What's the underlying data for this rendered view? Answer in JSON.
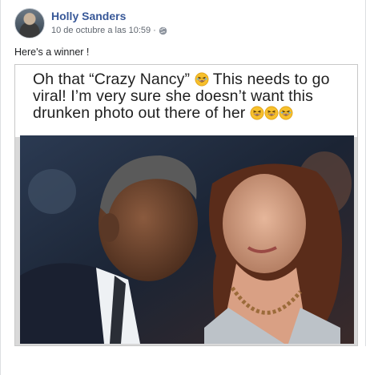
{
  "post": {
    "author": "Holly Sanders",
    "timestamp": "10 de octubre a las 10:59",
    "separator": "·",
    "privacy_icon": "globe-icon",
    "text": "Here's a winner !"
  },
  "media": {
    "caption_part1": "Oh that “Crazy Nancy”",
    "caption_part2": " This needs to go viral! I’m very sure she doesn’t want this drunken photo out there of her",
    "emoji_name": "laughing-emoji"
  },
  "colors": {
    "author_link": "#385898",
    "meta_gray": "#606770",
    "text": "#1c1e21"
  }
}
